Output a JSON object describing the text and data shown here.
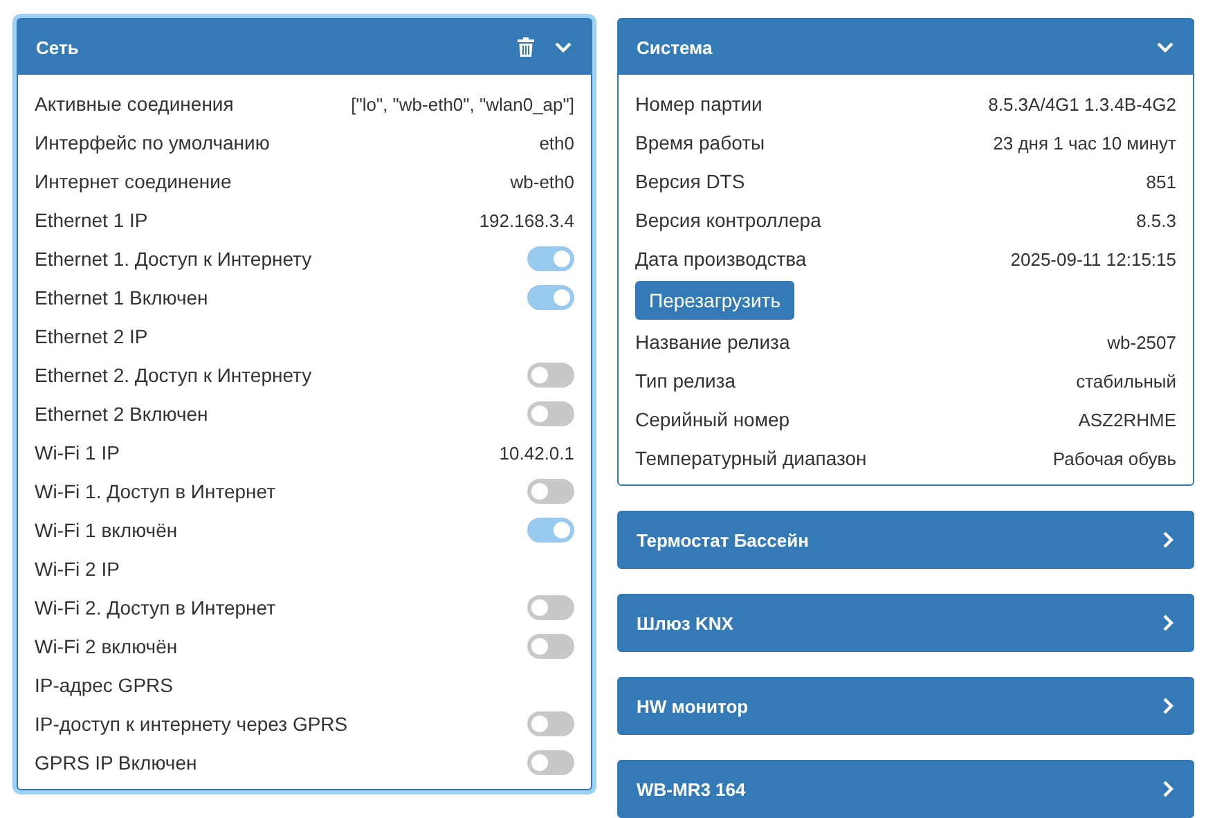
{
  "columns": [
    {
      "cards": [
        {
          "title": "Сеть",
          "selected": true,
          "expanded": true,
          "deletable": true,
          "rows": [
            {
              "kind": "value",
              "label": "Активные соединения",
              "value": "[\"lo\", \"wb-eth0\", \"wlan0_ap\"]"
            },
            {
              "kind": "value",
              "label": "Интерфейс по умолчанию",
              "value": "eth0"
            },
            {
              "kind": "value",
              "label": "Интернет соединение",
              "value": "wb-eth0"
            },
            {
              "kind": "value",
              "label": "Ethernet 1 IP",
              "value": "192.168.3.4"
            },
            {
              "kind": "switch",
              "label": "Ethernet 1. Доступ к Интернету",
              "on": true
            },
            {
              "kind": "switch",
              "label": "Ethernet 1 Включен",
              "on": true
            },
            {
              "kind": "value",
              "label": "Ethernet 2 IP"
            },
            {
              "kind": "switch",
              "label": "Ethernet 2. Доступ к Интернету",
              "on": false
            },
            {
              "kind": "switch",
              "label": "Ethernet 2 Включен",
              "on": false
            },
            {
              "kind": "value",
              "label": "Wi-Fi 1 IP",
              "value": "10.42.0.1"
            },
            {
              "kind": "switch",
              "label": "Wi-Fi 1. Доступ в Интернет",
              "on": false
            },
            {
              "kind": "switch",
              "label": "Wi-Fi 1 включён",
              "on": true
            },
            {
              "kind": "value",
              "label": "Wi-Fi 2 IP"
            },
            {
              "kind": "switch",
              "label": "Wi-Fi 2. Доступ в Интернет",
              "on": false
            },
            {
              "kind": "switch",
              "label": "Wi-Fi 2 включён",
              "on": false
            },
            {
              "kind": "value",
              "label": "IP-адрес GPRS"
            },
            {
              "kind": "switch",
              "label": "IP-доступ к интернету через GPRS",
              "on": false
            },
            {
              "kind": "switch",
              "label": "GPRS IP Включен",
              "on": false
            }
          ]
        }
      ]
    },
    {
      "cards": [
        {
          "title": "Система",
          "selected": false,
          "expanded": true,
          "deletable": false,
          "rows": [
            {
              "kind": "value",
              "label": "Номер партии",
              "value": "8.5.3A/4G1 1.3.4B-4G2"
            },
            {
              "kind": "value",
              "label": "Время работы",
              "value": "23 дня 1 час 10 минут"
            },
            {
              "kind": "value",
              "label": "Версия DTS",
              "value": "851"
            },
            {
              "kind": "value",
              "label": "Версия контроллера",
              "value": "8.5.3"
            },
            {
              "kind": "value",
              "label": "Дата производства",
              "value": "2025-09-11 12:15:15"
            },
            {
              "kind": "button",
              "label": "Перезагрузить"
            },
            {
              "kind": "value",
              "label": "Название релиза",
              "value": "wb-2507"
            },
            {
              "kind": "value",
              "label": "Тип релиза",
              "value": "стабильный"
            },
            {
              "kind": "value",
              "label": "Серийный номер",
              "value": "ASZ2RHME"
            },
            {
              "kind": "value",
              "label": "Температурный диапазон",
              "value": "Рабочая обувь"
            }
          ]
        },
        {
          "title": "Термостат Бассейн",
          "selected": false,
          "expanded": false,
          "deletable": false
        },
        {
          "title": "Шлюз KNX",
          "selected": false,
          "expanded": false,
          "deletable": false
        },
        {
          "title": "HW монитор",
          "selected": false,
          "expanded": false,
          "deletable": false
        },
        {
          "title": "WB-MR3 164",
          "selected": false,
          "expanded": false,
          "deletable": false
        }
      ]
    }
  ]
}
